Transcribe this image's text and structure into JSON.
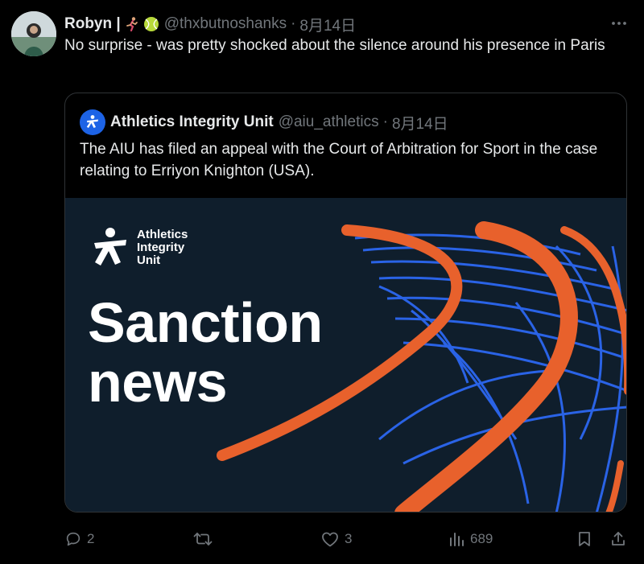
{
  "tweet": {
    "display_name": "Robyn |",
    "name_emojis": [
      "runner-emoji",
      "tennis-ball-emoji"
    ],
    "handle": "@thxbutnoshanks",
    "separator": "·",
    "date": "8月14日",
    "text": "No surprise - was pretty shocked about the silence around his presence in Paris",
    "more_icon": "more-horizontal-icon"
  },
  "quote": {
    "name": "Athletics Integrity Unit",
    "handle": "@aiu_athletics",
    "separator": "·",
    "date": "8月14日",
    "text": "The AIU has filed an appeal with the Court of Arbitration for Sport in the case relating to Erriyon Knighton (USA).",
    "media": {
      "logo_lines": [
        "Athletics",
        "Integrity",
        "Unit"
      ],
      "headline_lines": [
        "Sanction",
        "news"
      ],
      "background_color": "#0f1e2c",
      "track_line_color": "#2a63e6",
      "accent_color": "#e8612c"
    }
  },
  "actions": {
    "reply": {
      "icon": "reply-icon",
      "count": "2"
    },
    "repost": {
      "icon": "repost-icon",
      "count": ""
    },
    "like": {
      "icon": "like-icon",
      "count": "3"
    },
    "views": {
      "icon": "views-icon",
      "count": "689"
    },
    "bookmark": {
      "icon": "bookmark-icon"
    },
    "share": {
      "icon": "share-icon"
    }
  }
}
